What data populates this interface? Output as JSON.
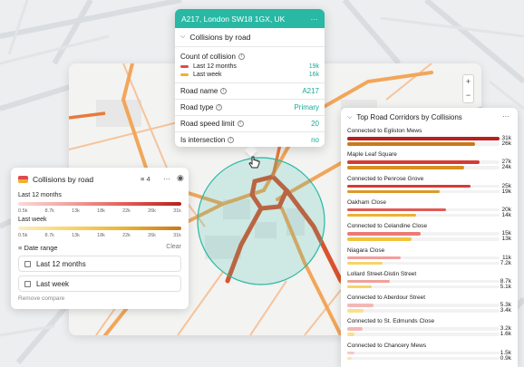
{
  "popup": {
    "address": "A217, London SW18 1GX, UK",
    "more": "···",
    "section": "Collisions by road",
    "count_label": "Count of collision",
    "series": [
      {
        "label": "Last 12 months",
        "value": "19k",
        "color": "#e04a4a"
      },
      {
        "label": "Last week",
        "value": "16k",
        "color": "#f0b030"
      }
    ],
    "fields": [
      {
        "label": "Road name",
        "value": "A217"
      },
      {
        "label": "Road type",
        "value": "Primary"
      },
      {
        "label": "Road speed limit",
        "value": "20"
      },
      {
        "label": "Is intersection",
        "value": "no"
      }
    ]
  },
  "map": {
    "zoom_in": "+",
    "zoom_out": "−"
  },
  "legend": {
    "title": "Collisions by road",
    "filter_count": "4",
    "more": "···",
    "last12_label": "Last 12 months",
    "lastweek_label": "Last week",
    "ticks": [
      "0.5k",
      "8.7k",
      "13k",
      "18k",
      "22k",
      "26k",
      "31k"
    ],
    "date_range_label": "Date range",
    "clear": "Clear",
    "dates": [
      "Last 12 months",
      "Last week"
    ],
    "remove": "Remove compare"
  },
  "corridors": {
    "title": "Top Road Corridors by Collisions",
    "more": "···",
    "items": [
      {
        "name": "Connected to Egliston Mews",
        "v1": "31k",
        "v2": "26k",
        "f1": 1.0,
        "f2": 0.84,
        "c1": "#b8201c",
        "c2": "#c9781a"
      },
      {
        "name": "Maple Leaf Square",
        "v1": "27k",
        "v2": "24k",
        "f1": 0.87,
        "f2": 0.77,
        "c1": "#d63a36",
        "c2": "#d88e22"
      },
      {
        "name": "Connected to Penrose Grove",
        "v1": "25k",
        "v2": "19k",
        "f1": 0.81,
        "f2": 0.61,
        "c1": "#d63a36",
        "c2": "#dc9a28"
      },
      {
        "name": "Oakham Close",
        "v1": "20k",
        "v2": "14k",
        "f1": 0.65,
        "f2": 0.45,
        "c1": "#e25a56",
        "c2": "#e8b232"
      },
      {
        "name": "Connected to Celandine Close",
        "v1": "15k",
        "v2": "13k",
        "f1": 0.48,
        "f2": 0.42,
        "c1": "#ea7a76",
        "c2": "#f0c33e"
      },
      {
        "name": "Niagara Close",
        "v1": "11k",
        "v2": "7.2k",
        "f1": 0.35,
        "f2": 0.23,
        "c1": "#f0a09c",
        "c2": "#f6d468"
      },
      {
        "name": "Lollard Street-Distin Street",
        "v1": "8.7k",
        "v2": "5.1k",
        "f1": 0.28,
        "f2": 0.16,
        "c1": "#f0a09c",
        "c2": "#f6d468"
      },
      {
        "name": "Connected to Aberdour Street",
        "v1": "5.3k",
        "v2": "3.4k",
        "f1": 0.17,
        "f2": 0.11,
        "c1": "#f4b8b5",
        "c2": "#f8e08c"
      },
      {
        "name": "Connected to St. Edmunds Close",
        "v1": "3.2k",
        "v2": "1.6k",
        "f1": 0.1,
        "f2": 0.05,
        "c1": "#f4b8b5",
        "c2": "#f8e08c"
      },
      {
        "name": "Connected to Chancery Mews",
        "v1": "1.5k",
        "v2": "0.9k",
        "f1": 0.05,
        "f2": 0.03,
        "c1": "#f6c8c5",
        "c2": "#fae7a6"
      }
    ]
  },
  "colors": {
    "accent": "#28b8a4",
    "road_hot": "#d43a2a",
    "road_warm": "#f2a65a"
  }
}
